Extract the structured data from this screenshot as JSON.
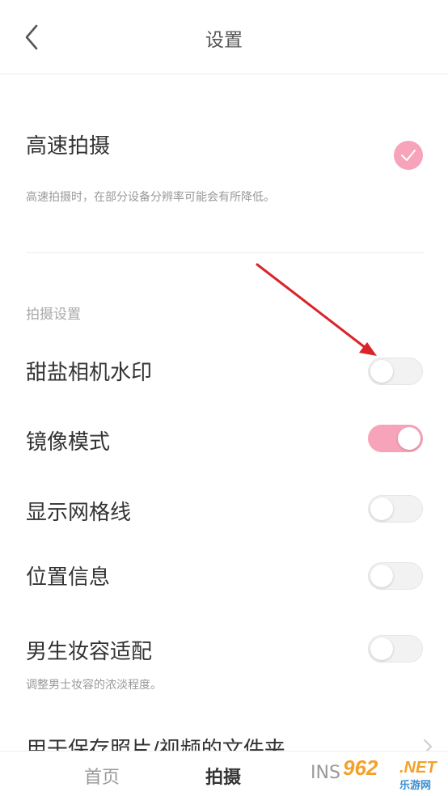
{
  "header": {
    "title": "设置",
    "back_icon": "chevron-left-icon"
  },
  "high_speed": {
    "label": "高速拍摄",
    "description": "高速拍摄时，在部分设备分辨率可能会有所降低。",
    "checked": true,
    "icon": "checkmark-icon"
  },
  "shooting_section": {
    "title": "拍摄设置",
    "items": [
      {
        "label": "甜盐相机水印",
        "on": false
      },
      {
        "label": "镜像模式",
        "on": true
      },
      {
        "label": "显示网格线",
        "on": false
      },
      {
        "label": "位置信息",
        "on": false
      },
      {
        "label": "男生妆容适配",
        "on": false,
        "description": "调整男士妆容的浓淡程度。"
      }
    ]
  },
  "partial_row": {
    "label": "用于保存照片/视频的文件夹",
    "icon": "chevron-right-icon"
  },
  "tabbar": {
    "tabs": [
      {
        "label": "首页",
        "active": false
      },
      {
        "label": "拍摄",
        "active": true
      },
      {
        "label": "INS",
        "active": false
      }
    ]
  },
  "watermark": {
    "number": "962",
    "domain": ".NET",
    "cn": "乐游网"
  },
  "colors": {
    "accent_pink": "#f7a3ba",
    "annotation_arrow": "#d9242a",
    "watermark_orange": "#f3a12a",
    "watermark_blue": "#3a8fd1"
  }
}
